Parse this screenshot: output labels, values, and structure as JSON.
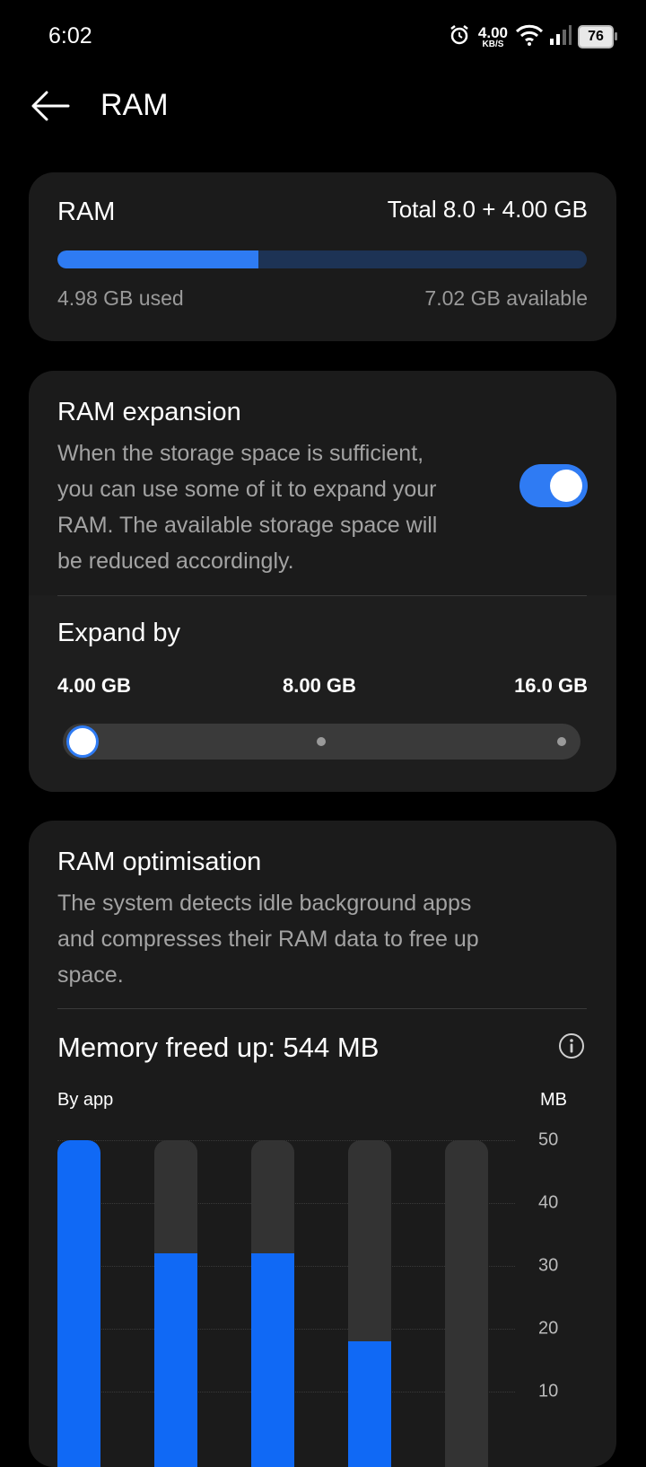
{
  "status": {
    "time": "6:02",
    "speed_value": "4.00",
    "speed_unit": "KB/S",
    "battery": "76"
  },
  "header": {
    "title": "RAM"
  },
  "ram_card": {
    "title": "RAM",
    "total": "Total 8.0 + 4.00 GB",
    "used_fraction": 0.38,
    "used": "4.98 GB used",
    "available": "7.02 GB available"
  },
  "expansion": {
    "title": "RAM expansion",
    "description": [
      "When the storage space is sufficient,",
      "you can use some of it to expand your",
      "RAM. The available storage space will",
      "be reduced accordingly."
    ],
    "enabled": true,
    "expand_title": "Expand by",
    "options": [
      "4.00 GB",
      "8.00 GB",
      "16.0 GB"
    ],
    "selected_index": 0
  },
  "optimisation": {
    "title": "RAM optimisation",
    "description": [
      "The system detects idle background apps",
      "and compresses their RAM data to free up",
      "space."
    ],
    "memory_freed": "Memory freed up: 544 MB",
    "by_app_label": "By app",
    "unit": "MB"
  },
  "chart_data": {
    "type": "bar",
    "categories": [
      "",
      "",
      "",
      "",
      ""
    ],
    "values": [
      50,
      32,
      32,
      18,
      0
    ],
    "ylabel": "MB",
    "yticks": [
      50,
      40,
      30,
      20,
      10
    ],
    "ylim": [
      0,
      50
    ],
    "grid": true,
    "colors": {
      "fill": "#1069f5",
      "track": "#333333"
    }
  }
}
